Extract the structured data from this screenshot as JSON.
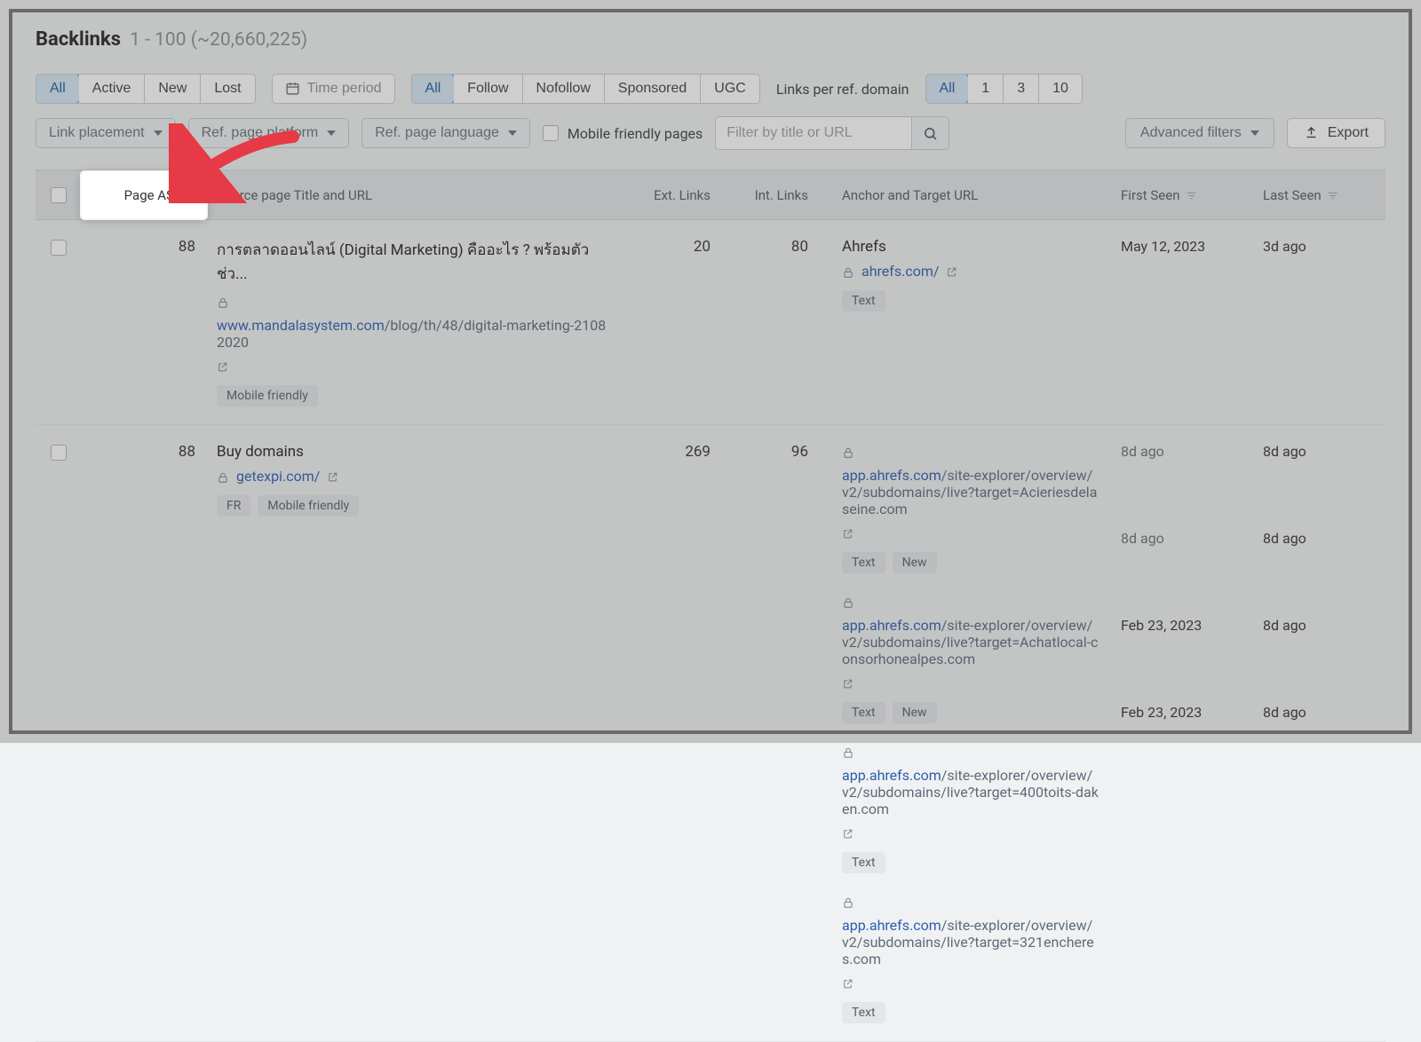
{
  "header": {
    "title": "Backlinks",
    "range": "1 - 100 (~20,660,225)"
  },
  "toolbar": {
    "mode_group": [
      "All",
      "Active",
      "New",
      "Lost"
    ],
    "mode_active_index": 0,
    "time_period_label": "Time period",
    "follow_group": [
      "All",
      "Follow",
      "Nofollow",
      "Sponsored",
      "UGC"
    ],
    "follow_active_index": 0,
    "links_per_domain_label": "Links per ref. domain",
    "links_per_domain_group": [
      "All",
      "1",
      "3",
      "10"
    ],
    "links_per_domain_active_index": 0,
    "dropdowns": {
      "link_placement": "Link placement",
      "ref_page_platform": "Ref. page platform",
      "ref_page_language": "Ref. page language"
    },
    "mobile_friendly_label": "Mobile friendly pages",
    "search_placeholder": "Filter by title or URL",
    "advanced_filters_label": "Advanced filters",
    "export_label": "Export"
  },
  "columns": {
    "page_as": "Page AS",
    "source": "Source page Title and URL",
    "ext_links": "Ext. Links",
    "int_links": "Int. Links",
    "anchor": "Anchor and Target URL",
    "first_seen": "First Seen",
    "last_seen": "Last Seen"
  },
  "rows": [
    {
      "page_as": "88",
      "source": {
        "title": "การตลาดออนไลน์ (Digital Marketing) คืออะไร ? พร้อมตัวช่ว...",
        "domain": "www.mandalasystem.com",
        "path": "/blog/th/48/digital-marketing-21082020",
        "tags": [
          "Mobile friendly"
        ]
      },
      "ext_links": "20",
      "int_links": "80",
      "anchors": [
        {
          "title": "Ahrefs",
          "domain": "ahrefs.com/",
          "path": "",
          "tags": [
            "Text"
          ],
          "first_seen": "May 12, 2023",
          "last_seen": "3d ago",
          "first_muted": false
        }
      ]
    },
    {
      "page_as": "88",
      "source": {
        "title": "Buy domains",
        "domain": "getexpi.com/",
        "path": "",
        "tags": [
          "FR",
          "Mobile friendly"
        ]
      },
      "ext_links": "269",
      "int_links": "96",
      "anchors": [
        {
          "title": "",
          "domain": "app.ahrefs.com",
          "path": "/site-explorer/overview/v2/subdomains/live?target=Acieriesdelaseine.com",
          "tags": [
            "Text",
            "New"
          ],
          "first_seen": "8d ago",
          "last_seen": "8d ago",
          "first_muted": true
        },
        {
          "title": "",
          "domain": "app.ahrefs.com",
          "path": "/site-explorer/overview/v2/subdomains/live?target=Achatlocal-consorhonealpes.com",
          "tags": [
            "Text",
            "New"
          ],
          "first_seen": "8d ago",
          "last_seen": "8d ago",
          "first_muted": true
        },
        {
          "title": "",
          "domain": "app.ahrefs.com",
          "path": "/site-explorer/overview/v2/subdomains/live?target=400toits-daken.com",
          "tags": [
            "Text"
          ],
          "first_seen": "Feb 23, 2023",
          "last_seen": "8d ago",
          "first_muted": false
        },
        {
          "title": "",
          "domain": "app.ahrefs.com",
          "path": "/site-explorer/overview/v2/subdomains/live?target=321encheres.com",
          "tags": [
            "Text"
          ],
          "first_seen": "Feb 23, 2023",
          "last_seen": "8d ago",
          "first_muted": false
        }
      ]
    }
  ]
}
